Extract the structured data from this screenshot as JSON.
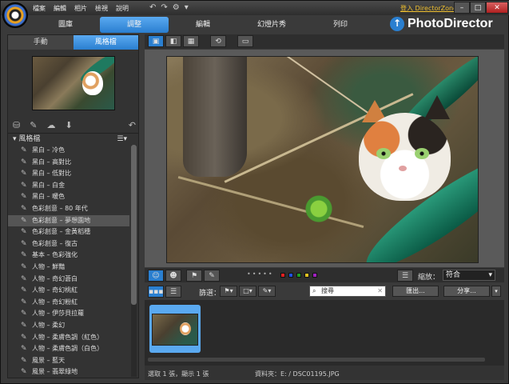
{
  "titlebar": {
    "menus": [
      "檔案",
      "編輯",
      "相片",
      "檢視",
      "說明"
    ],
    "login": "登入 DirectorZone",
    "window_buttons": {
      "minimize": "–",
      "maximize": "□",
      "close": "✕"
    }
  },
  "main_tabs": [
    {
      "label": "圖庫",
      "active": false
    },
    {
      "label": "調整",
      "active": true
    },
    {
      "label": "編輯",
      "active": false
    },
    {
      "label": "幻燈片秀",
      "active": false
    },
    {
      "label": "列印",
      "active": false
    }
  ],
  "brand": {
    "name": "PhotoDirector",
    "accent": "#2a7fd0"
  },
  "left_panel": {
    "subtabs": [
      {
        "label": "手動",
        "active": false
      },
      {
        "label": "風格檔",
        "active": true
      }
    ],
    "list_header": "風格檔",
    "presets": [
      {
        "label": "黑白 – 冷色",
        "selected": false
      },
      {
        "label": "黑白 – 高對比",
        "selected": false
      },
      {
        "label": "黑白 – 低對比",
        "selected": false
      },
      {
        "label": "黑白 – 白金",
        "selected": false
      },
      {
        "label": "黑白 – 暖色",
        "selected": false
      },
      {
        "label": "色彩創意 – 80 年代",
        "selected": false
      },
      {
        "label": "色彩創意 – 夢想園地",
        "selected": true
      },
      {
        "label": "色彩創意 – 金黃稻穗",
        "selected": false
      },
      {
        "label": "色彩創意 – 復古",
        "selected": false
      },
      {
        "label": "基本 – 色彩強化",
        "selected": false
      },
      {
        "label": "人物 – 鮮豔",
        "selected": false
      },
      {
        "label": "人物 – 奇幻蒼白",
        "selected": false
      },
      {
        "label": "人物 – 奇幻桃紅",
        "selected": false
      },
      {
        "label": "人物 – 奇幻粉紅",
        "selected": false
      },
      {
        "label": "人物 – 伊莎貝拉蘿",
        "selected": false
      },
      {
        "label": "人物 – 柔幻",
        "selected": false
      },
      {
        "label": "人物 – 柔膚色調（紅色）",
        "selected": false
      },
      {
        "label": "人物 – 柔膚色調（白色）",
        "selected": false
      },
      {
        "label": "風景 – 藍天",
        "selected": false
      },
      {
        "label": "風景 – 翡翠綠地",
        "selected": false
      }
    ]
  },
  "bottom": {
    "filter_label": "篩選：",
    "search_placeholder": "搜尋",
    "export_label": "匯出...",
    "share_label": "分享...",
    "zoom_label": "縮放：",
    "zoom_value": "符合",
    "swatch_colors": [
      "#e02020",
      "#2050e0",
      "#20a020",
      "#e0c020",
      "#a020c0"
    ]
  },
  "status": {
    "selection": "選取 1 張，顯示 1 張",
    "folder": "資料夾：E: / DSC01195.JPG"
  }
}
